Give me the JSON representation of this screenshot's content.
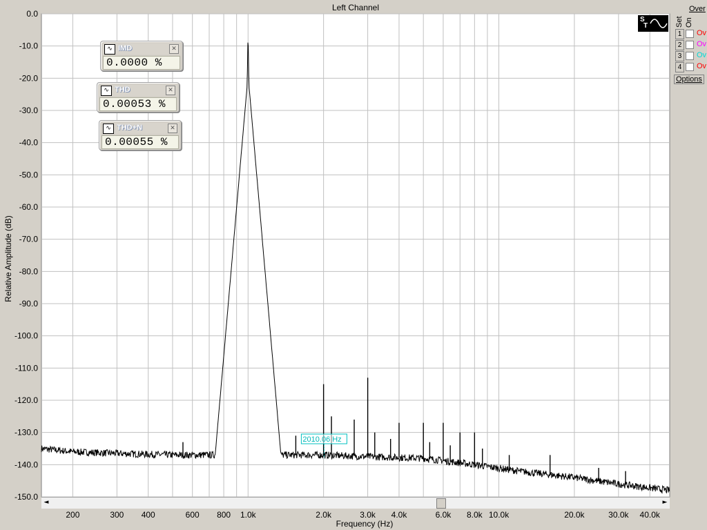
{
  "window": {
    "title": "Left Channel"
  },
  "chart_data": {
    "type": "line",
    "title": "Left Channel",
    "xlabel": "Frequency (Hz)",
    "ylabel": "Relative Amplitude (dB)",
    "xscale": "log",
    "xlim": [
      150,
      48000
    ],
    "ylim": [
      -150,
      0
    ],
    "grid": true,
    "y_ticks": [
      "0.0",
      "-10.0",
      "-20.0",
      "-30.0",
      "-40.0",
      "-50.0",
      "-60.0",
      "-70.0",
      "-80.0",
      "-90.0",
      "-100.0",
      "-110.0",
      "-120.0",
      "-130.0",
      "-140.0",
      "-150.0"
    ],
    "x_ticks": [
      {
        "v": 200,
        "label": "200"
      },
      {
        "v": 300,
        "label": "300"
      },
      {
        "v": 400,
        "label": "400"
      },
      {
        "v": 600,
        "label": "600"
      },
      {
        "v": 800,
        "label": "800"
      },
      {
        "v": 1000,
        "label": "1.0k"
      },
      {
        "v": 2000,
        "label": "2.0k"
      },
      {
        "v": 3000,
        "label": "3.0k"
      },
      {
        "v": 4000,
        "label": "4.0k"
      },
      {
        "v": 6000,
        "label": "6.0k"
      },
      {
        "v": 8000,
        "label": "8.0k"
      },
      {
        "v": 10000,
        "label": "10.0k"
      },
      {
        "v": 20000,
        "label": "20.0k"
      },
      {
        "v": 30000,
        "label": "30.0k"
      },
      {
        "v": 40000,
        "label": "40.0k"
      }
    ],
    "fundamental": {
      "x": 1000,
      "y": -5
    },
    "noise_floor": [
      [
        150,
        -135
      ],
      [
        200,
        -136
      ],
      [
        300,
        -136.5
      ],
      [
        500,
        -137
      ],
      [
        900,
        -137
      ],
      [
        2000,
        -137
      ],
      [
        3000,
        -137.5
      ],
      [
        5000,
        -138
      ],
      [
        8000,
        -140
      ],
      [
        12000,
        -142
      ],
      [
        20000,
        -144
      ],
      [
        30000,
        -146
      ],
      [
        48000,
        -148
      ]
    ],
    "peaks": [
      {
        "x": 550,
        "y": -133
      },
      {
        "x": 1550,
        "y": -131
      },
      {
        "x": 2000,
        "y": -115
      },
      {
        "x": 2150,
        "y": -125
      },
      {
        "x": 2650,
        "y": -126
      },
      {
        "x": 3000,
        "y": -113
      },
      {
        "x": 3200,
        "y": -130
      },
      {
        "x": 3700,
        "y": -132
      },
      {
        "x": 4000,
        "y": -127
      },
      {
        "x": 5000,
        "y": -127
      },
      {
        "x": 5300,
        "y": -133
      },
      {
        "x": 6000,
        "y": -127
      },
      {
        "x": 6400,
        "y": -134
      },
      {
        "x": 7000,
        "y": -130
      },
      {
        "x": 8000,
        "y": -130
      },
      {
        "x": 8600,
        "y": -135
      },
      {
        "x": 11000,
        "y": -137
      },
      {
        "x": 16000,
        "y": -137
      },
      {
        "x": 25000,
        "y": -141
      },
      {
        "x": 32000,
        "y": -142
      }
    ],
    "cursor": {
      "x": 2010,
      "label": "2010.06 Hz"
    }
  },
  "meters": [
    {
      "label": "IMD",
      "value": "0.0000 %"
    },
    {
      "label": "THD",
      "value": "0.00053 %"
    },
    {
      "label": "THD+N",
      "value": "0.00055 %"
    }
  ],
  "right_panel": {
    "over_label": "Over",
    "set_label": "Set",
    "on_label": "On",
    "rows": [
      {
        "num": "1",
        "text": "Ov",
        "color": "#ff0000"
      },
      {
        "num": "2",
        "text": "Ov",
        "color": "#ff00ff"
      },
      {
        "num": "3",
        "text": "Ov",
        "color": "#00ffff"
      },
      {
        "num": "4",
        "text": "Ov",
        "color": "#ff0000"
      }
    ],
    "options_label": "Options"
  },
  "scrollbar": {
    "left_arrow": "◄",
    "right_arrow": "►"
  }
}
